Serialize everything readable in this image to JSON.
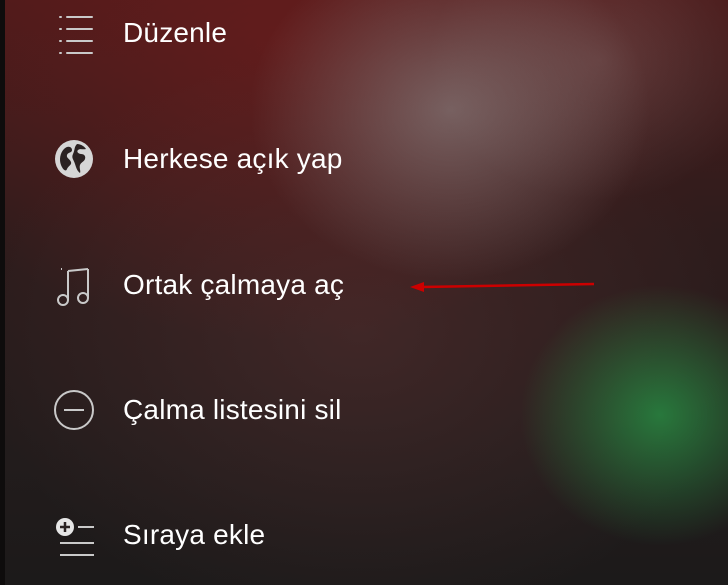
{
  "menu": {
    "items": [
      {
        "label": "Düzenle",
        "icon": "list-edit-icon"
      },
      {
        "label": "Herkese açık yap",
        "icon": "globe-icon"
      },
      {
        "label": "Ortak çalmaya aç",
        "icon": "music-note-icon"
      },
      {
        "label": "Çalma listesini sil",
        "icon": "minus-circle-icon"
      },
      {
        "label": "Sıraya ekle",
        "icon": "add-to-queue-icon"
      }
    ]
  },
  "annotation": {
    "arrow_color": "#cc0000",
    "points_to": "Ortak çalmaya aç"
  },
  "colors": {
    "text": "#ffffff",
    "icon": "#c9c9c9",
    "accent_green": "#2a9646"
  }
}
